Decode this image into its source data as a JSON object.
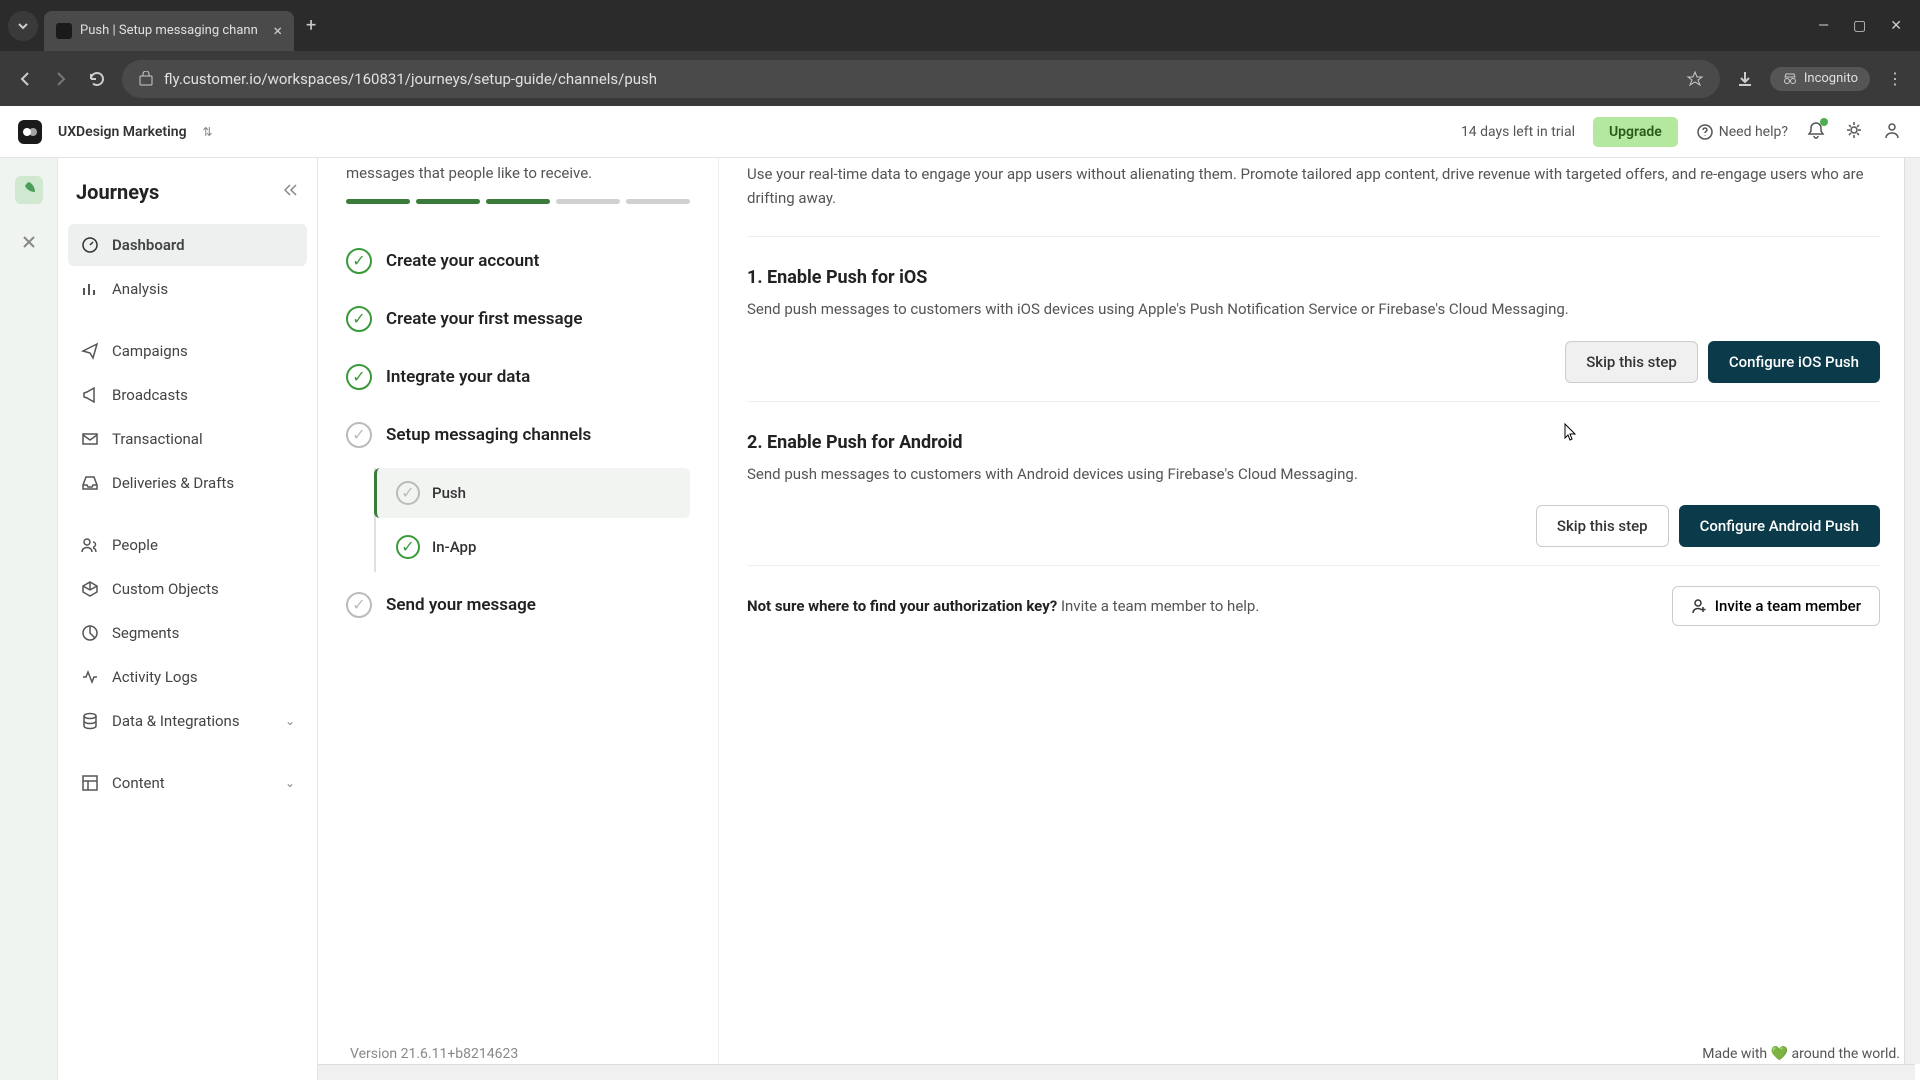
{
  "browser": {
    "tab_title": "Push | Setup messaging chann",
    "url": "fly.customer.io/workspaces/160831/journeys/setup-guide/channels/push",
    "incognito": "Incognito"
  },
  "header": {
    "workspace": "UXDesign Marketing",
    "trial": "14 days left in trial",
    "upgrade": "Upgrade",
    "help": "Need help?"
  },
  "sidebar": {
    "title": "Journeys",
    "items": {
      "dashboard": "Dashboard",
      "analysis": "Analysis",
      "campaigns": "Campaigns",
      "broadcasts": "Broadcasts",
      "transactional": "Transactional",
      "deliveries": "Deliveries & Drafts",
      "people": "People",
      "custom_objects": "Custom Objects",
      "segments": "Segments",
      "activity_logs": "Activity Logs",
      "data_integrations": "Data & Integrations",
      "content": "Content"
    }
  },
  "setup": {
    "desc": "messages that people like to receive.",
    "steps": {
      "create_account": "Create your account",
      "first_message": "Create your first message",
      "integrate": "Integrate your data",
      "channels": "Setup messaging channels",
      "push": "Push",
      "inapp": "In-App",
      "send": "Send your message"
    }
  },
  "detail": {
    "intro": "Use your real-time data to engage your app users without alienating them. Promote tailored app content, drive revenue with targeted offers, and re-engage users who are drifting away.",
    "ios": {
      "title": "1. Enable Push for iOS",
      "desc": "Send push messages to customers with iOS devices using Apple's Push Notification Service or Firebase's Cloud Messaging.",
      "skip": "Skip this step",
      "configure": "Configure iOS Push"
    },
    "android": {
      "title": "2. Enable Push for Android",
      "desc": "Send push messages to customers with Android devices using Firebase's Cloud Messaging.",
      "skip": "Skip this step",
      "configure": "Configure Android Push"
    },
    "invite": {
      "strong": "Not sure where to find your authorization key?",
      "rest": " Invite a team member to help.",
      "button": "Invite a team member"
    }
  },
  "footer": {
    "version": "Version 21.6.11+b8214623",
    "made": "Made with ",
    "world": " around the world."
  }
}
